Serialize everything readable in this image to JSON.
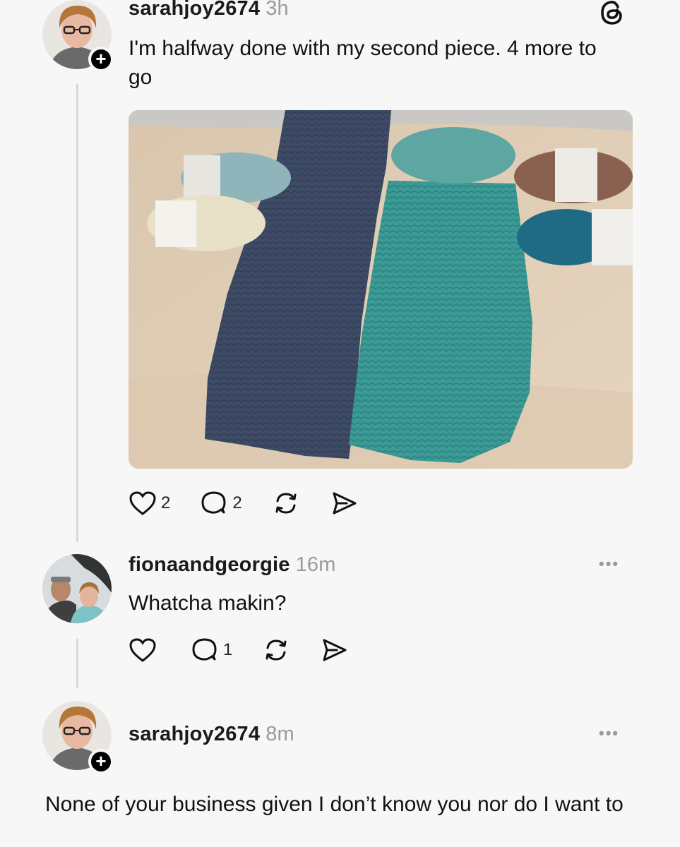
{
  "post": {
    "username": "sarahjoy2674",
    "time": "3h",
    "text": "I'm halfway done with my second piece. 4 more to go",
    "likes": "2",
    "replies": "2",
    "image_icon": "crochet-panels-photo"
  },
  "reply1": {
    "username": "fionaandgeorgie",
    "time": "16m",
    "text": "Whatcha makin?",
    "likes": "",
    "replies": "1"
  },
  "reply2": {
    "username": "sarahjoy2674",
    "time": "8m",
    "text": "None of your business given I don’t know you nor do I want to"
  },
  "icons": {
    "logo": "threads-logo-icon",
    "like": "heart-icon",
    "reply": "comment-icon",
    "repost": "repost-icon",
    "share": "send-icon",
    "more": "more-icon",
    "follow": "plus-icon"
  },
  "colors": {
    "background": "#f7f7f7",
    "text": "#111111",
    "muted": "#9a9a9a",
    "thread_line": "#d8d8d8"
  }
}
